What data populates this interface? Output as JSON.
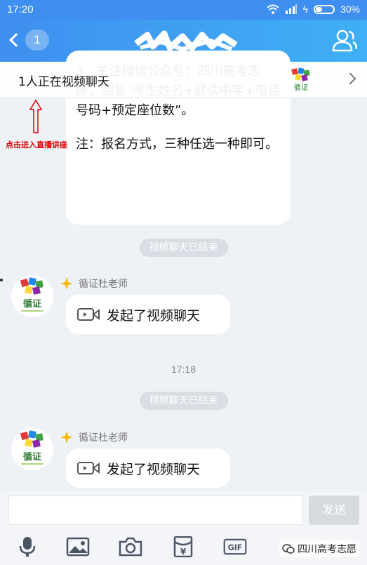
{
  "status_bar": {
    "time": "17:20",
    "battery": "30%",
    "signal": "4G"
  },
  "header": {
    "unread_count": "1"
  },
  "banner": {
    "text": "1人正在视频聊天"
  },
  "annotation": {
    "text": "点击进入直播讲座"
  },
  "messages": {
    "notice_line1": "3、关注微信公众号：四川高考志愿，回复“考生姓名+就读中学+电话号码+预定座位数”。",
    "notice_line2": "注：报名方式，三种任选一种即可。",
    "ended_1": "视频聊天已结束",
    "sender_1": "循证杜老师",
    "call_1": "发起了视频聊天",
    "time_1": "17:18",
    "ended_2": "视频聊天已结束",
    "sender_2": "循证杜老师",
    "call_2": "发起了视频聊天"
  },
  "logo_text": "循证",
  "input": {
    "placeholder": "",
    "send_label": "发送"
  },
  "toolbar": {
    "icons": [
      "mic-icon",
      "image-icon",
      "camera-icon",
      "red-packet-icon",
      "gif-icon",
      "emoji-icon"
    ],
    "gif_label": "GIF",
    "yen_label": "¥"
  },
  "watermark": {
    "text": "四川高考志愿"
  },
  "colors": {
    "header_blue": "#3f8ff0",
    "annotation_red": "#dd0000",
    "pill_gray": "#d9dde4",
    "star_yellow": "#f5b800"
  }
}
